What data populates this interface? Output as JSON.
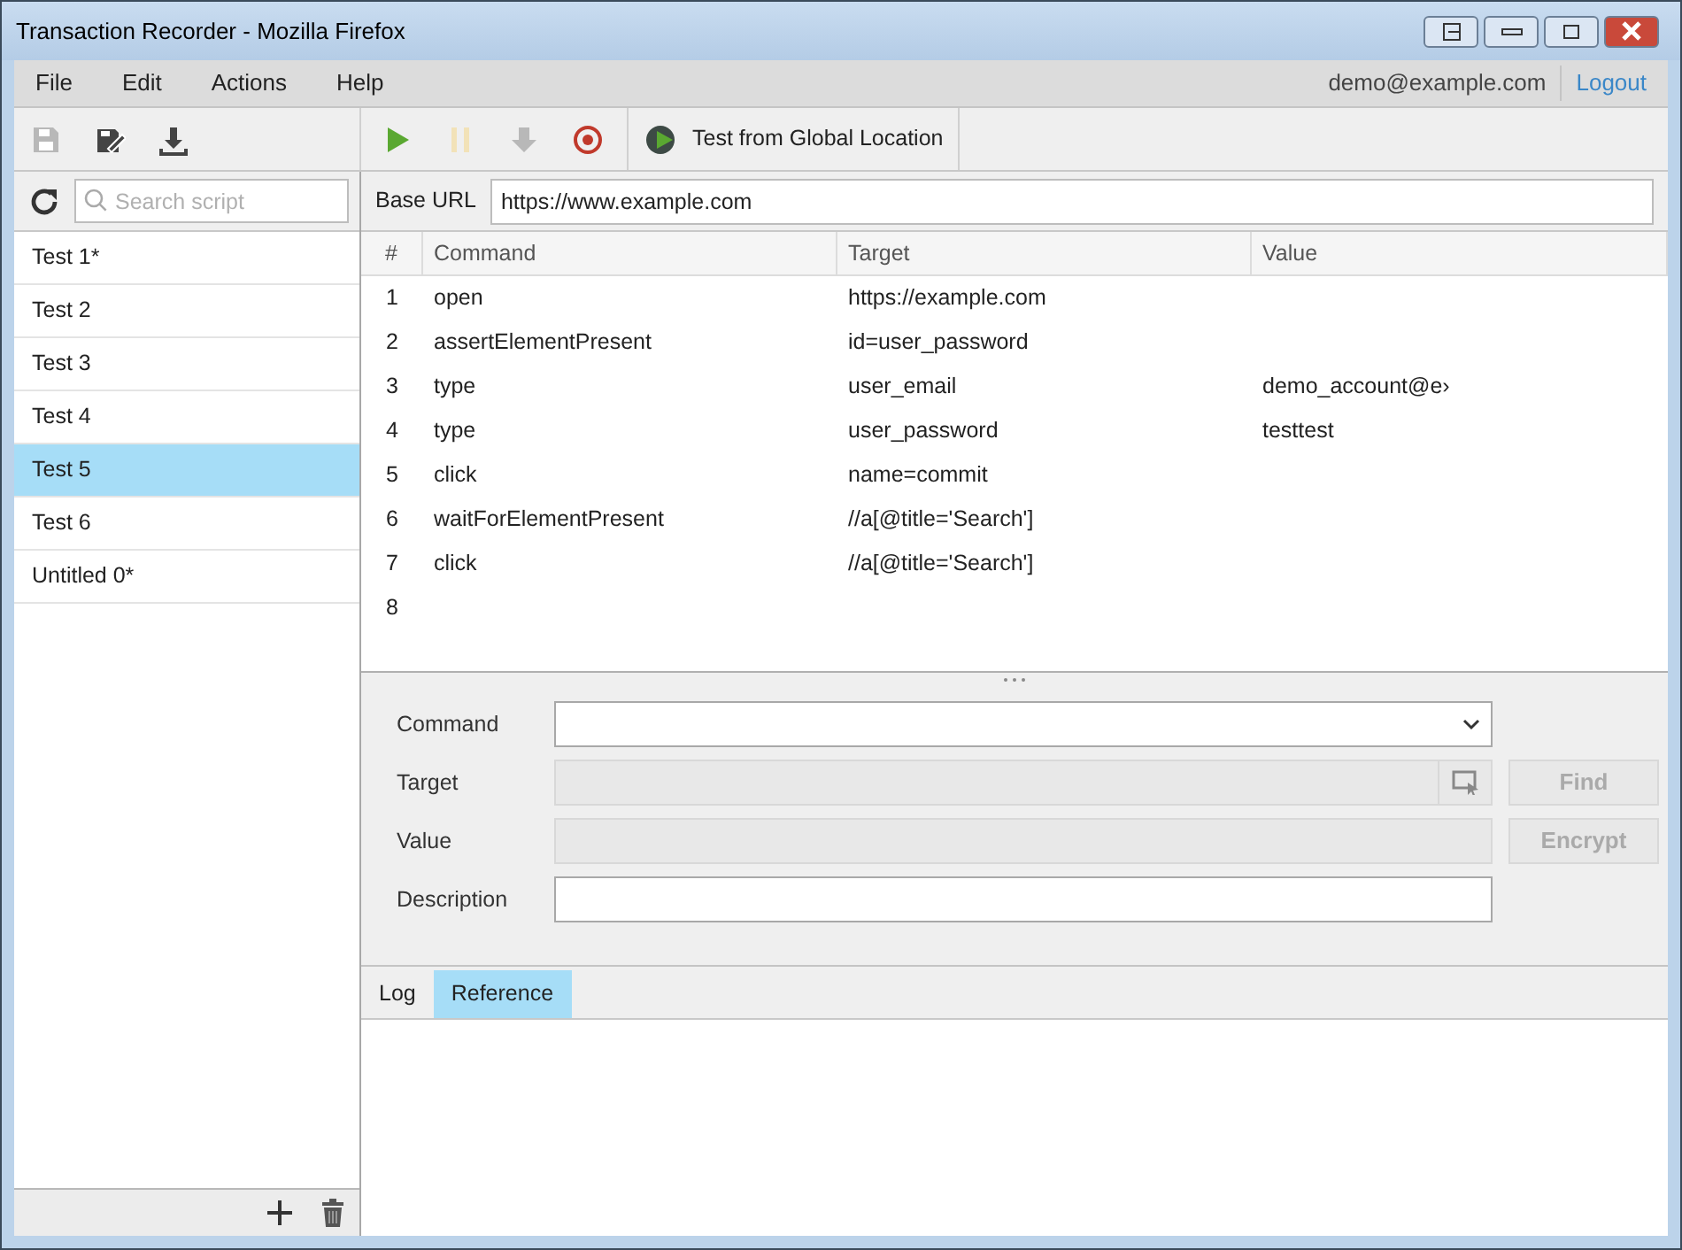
{
  "window": {
    "title": "Transaction Recorder - Mozilla Firefox"
  },
  "menu": [
    "File",
    "Edit",
    "Actions",
    "Help"
  ],
  "account": {
    "email": "demo@example.com",
    "logout": "Logout"
  },
  "toolbar": [
    {
      "kind": "save",
      "disabled": true
    },
    {
      "kind": "save-as",
      "disabled": false
    },
    {
      "kind": "download",
      "disabled": false
    },
    {
      "kind": "play",
      "disabled": false
    },
    {
      "kind": "pause",
      "disabled": true
    },
    {
      "kind": "step",
      "disabled": true
    },
    {
      "kind": "record",
      "disabled": false
    }
  ],
  "global_test": {
    "label": "Test from Global Location"
  },
  "search": {
    "placeholder": "Search script"
  },
  "tests": [
    {
      "label": "Test 1*",
      "selected": false
    },
    {
      "label": "Test 2",
      "selected": false
    },
    {
      "label": "Test 3",
      "selected": false
    },
    {
      "label": "Test 4",
      "selected": false
    },
    {
      "label": "Test 5",
      "selected": true
    },
    {
      "label": "Test 6",
      "selected": false
    },
    {
      "label": "Untitled 0*",
      "selected": false
    }
  ],
  "base_url": {
    "label": "Base URL",
    "value": "https://www.example.com"
  },
  "table": {
    "columns": [
      "#",
      "Command",
      "Target",
      "Value"
    ],
    "rows": [
      [
        "1",
        "open",
        "https://example.com",
        ""
      ],
      [
        "2",
        "assertElementPresent",
        "id=user_password",
        ""
      ],
      [
        "3",
        "type",
        "user_email",
        "demo_account@e›"
      ],
      [
        "4",
        "type",
        "user_password",
        "testtest"
      ],
      [
        "5",
        "click",
        "name=commit",
        ""
      ],
      [
        "6",
        "waitForElementPresent",
        "//a[@title='Search']",
        ""
      ],
      [
        "7",
        "click",
        "//a[@title='Search']",
        ""
      ],
      [
        "8",
        "",
        "",
        ""
      ]
    ]
  },
  "editor": {
    "command_label": "Command",
    "target_label": "Target",
    "value_label": "Value",
    "description_label": "Description",
    "target_disabled": true,
    "value_disabled": true,
    "find": {
      "label": "Find",
      "disabled": true
    },
    "encrypt": {
      "label": "Encrypt",
      "disabled": true
    }
  },
  "bottom_tabs": [
    {
      "label": "Log",
      "selected": false
    },
    {
      "label": "Reference",
      "selected": true
    }
  ]
}
